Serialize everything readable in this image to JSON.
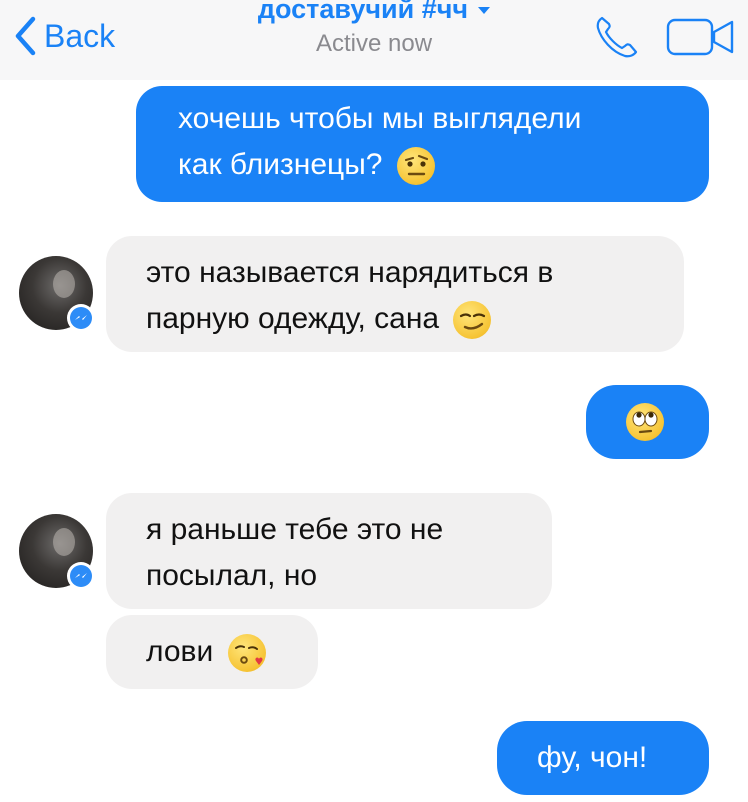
{
  "header": {
    "back_label": "Back",
    "title": "доставучий #чч",
    "status": "Active now"
  },
  "messages": [
    {
      "side": "outgoing",
      "line1": "хочешь чтобы мы выглядели",
      "line2": "как близнецы?",
      "emoji": "raised-eyebrow-emoji"
    },
    {
      "side": "incoming",
      "line1": "это называется нарядиться в",
      "line2": "парную одежду, сана",
      "emoji": "smirking-face-emoji"
    },
    {
      "side": "outgoing",
      "emoji": "face-with-rolling-eyes-emoji"
    },
    {
      "side": "incoming",
      "line1": "я раньше тебе это не",
      "line2": "посылал, но"
    },
    {
      "side": "incoming",
      "line1": "лови",
      "emoji": "face-blowing-kiss-emoji"
    },
    {
      "side": "outgoing",
      "line1": "фу, чон!"
    }
  ],
  "colors": {
    "accent": "#1a82f6",
    "incoming_bubble": "#f1f0f0",
    "header_bg": "#f7f7f8",
    "status_text": "#8a8a8f"
  },
  "icons": [
    "chevron-left-icon",
    "phone-icon",
    "video-camera-icon",
    "messenger-badge-icon"
  ]
}
